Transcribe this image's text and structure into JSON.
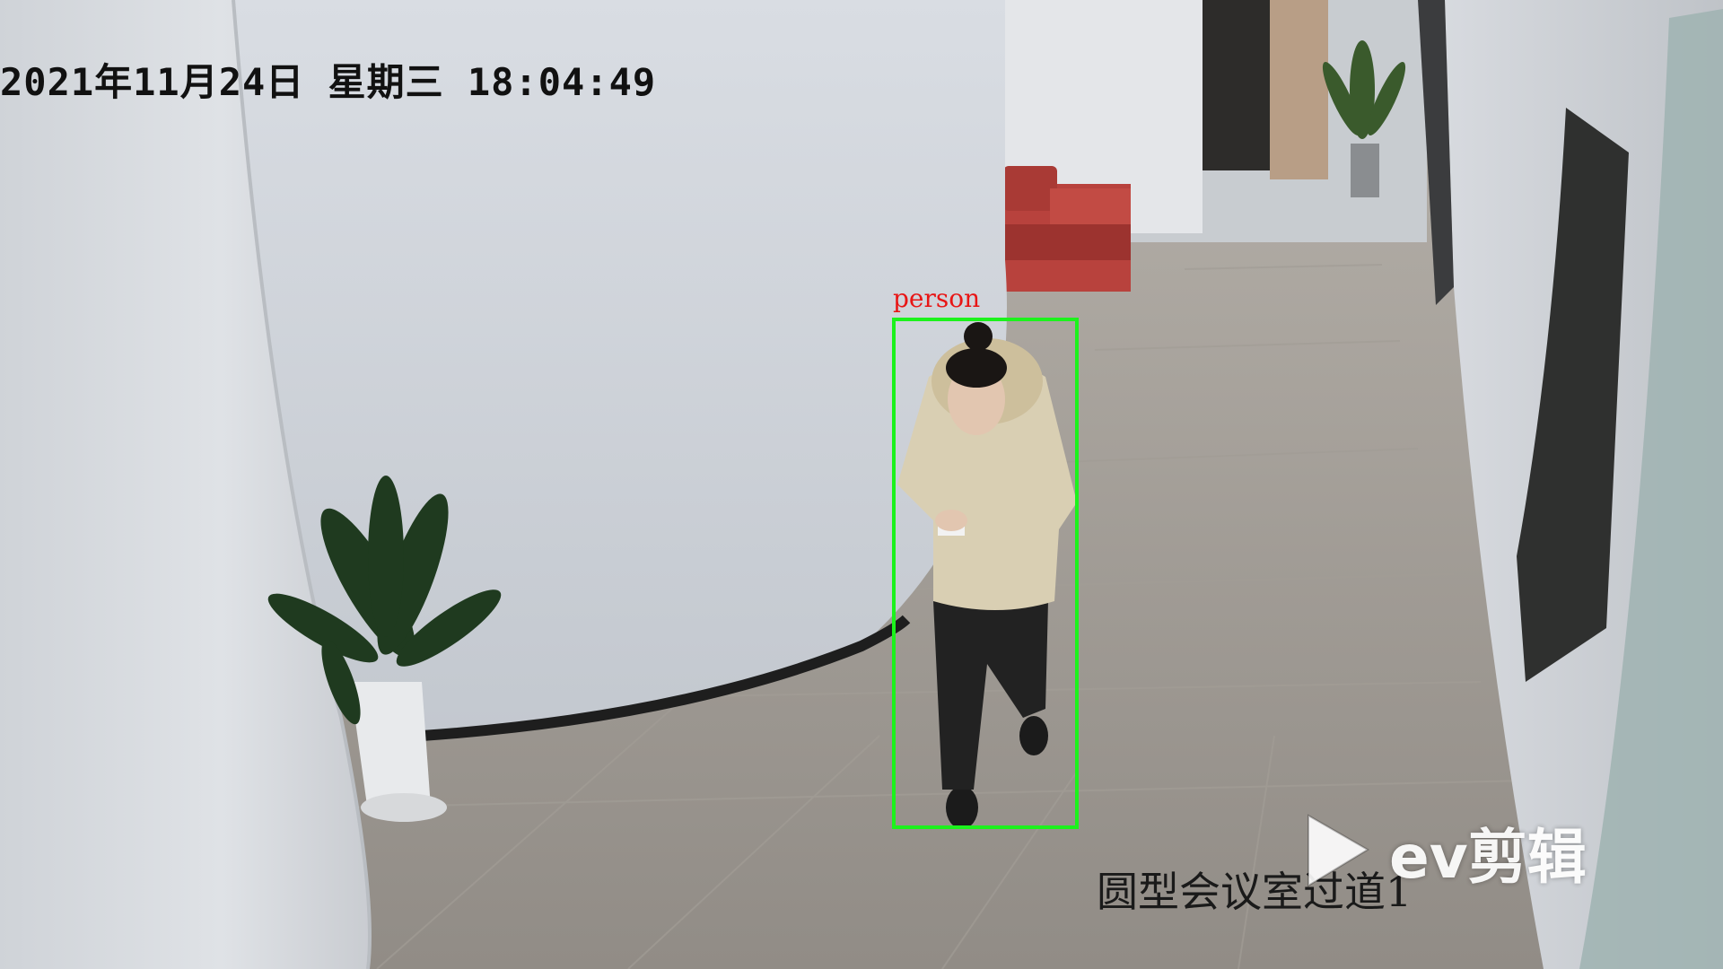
{
  "overlay": {
    "timestamp": "2021年11月24日  星期三  18:04:49",
    "camera_location": "圆型会议室过道1"
  },
  "detection": {
    "label": "person",
    "box_color": "#1cf21c",
    "label_color": "#e81515"
  },
  "watermark": {
    "text": "ev剪辑",
    "icon": "play-icon"
  }
}
